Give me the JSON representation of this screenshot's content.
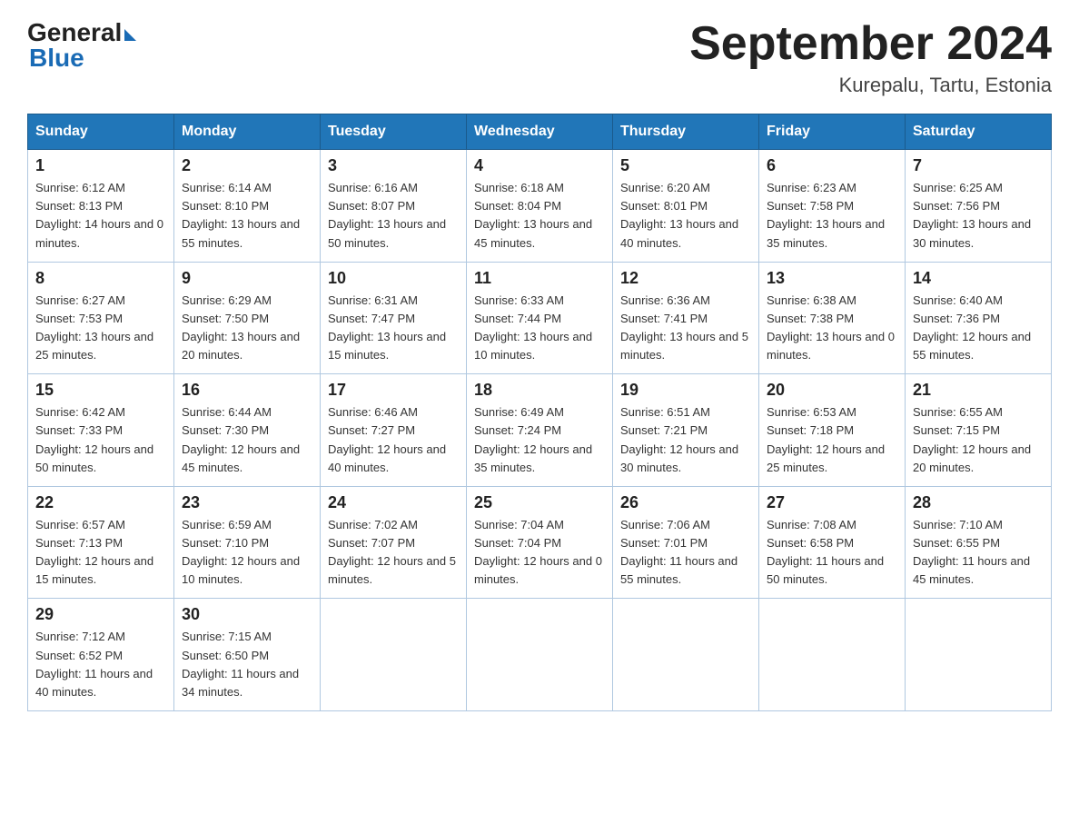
{
  "header": {
    "title": "September 2024",
    "subtitle": "Kurepalu, Tartu, Estonia",
    "logo_general": "General",
    "logo_blue": "Blue"
  },
  "days_of_week": [
    "Sunday",
    "Monday",
    "Tuesday",
    "Wednesday",
    "Thursday",
    "Friday",
    "Saturday"
  ],
  "weeks": [
    [
      {
        "day": "1",
        "sunrise": "Sunrise: 6:12 AM",
        "sunset": "Sunset: 8:13 PM",
        "daylight": "Daylight: 14 hours and 0 minutes."
      },
      {
        "day": "2",
        "sunrise": "Sunrise: 6:14 AM",
        "sunset": "Sunset: 8:10 PM",
        "daylight": "Daylight: 13 hours and 55 minutes."
      },
      {
        "day": "3",
        "sunrise": "Sunrise: 6:16 AM",
        "sunset": "Sunset: 8:07 PM",
        "daylight": "Daylight: 13 hours and 50 minutes."
      },
      {
        "day": "4",
        "sunrise": "Sunrise: 6:18 AM",
        "sunset": "Sunset: 8:04 PM",
        "daylight": "Daylight: 13 hours and 45 minutes."
      },
      {
        "day": "5",
        "sunrise": "Sunrise: 6:20 AM",
        "sunset": "Sunset: 8:01 PM",
        "daylight": "Daylight: 13 hours and 40 minutes."
      },
      {
        "day": "6",
        "sunrise": "Sunrise: 6:23 AM",
        "sunset": "Sunset: 7:58 PM",
        "daylight": "Daylight: 13 hours and 35 minutes."
      },
      {
        "day": "7",
        "sunrise": "Sunrise: 6:25 AM",
        "sunset": "Sunset: 7:56 PM",
        "daylight": "Daylight: 13 hours and 30 minutes."
      }
    ],
    [
      {
        "day": "8",
        "sunrise": "Sunrise: 6:27 AM",
        "sunset": "Sunset: 7:53 PM",
        "daylight": "Daylight: 13 hours and 25 minutes."
      },
      {
        "day": "9",
        "sunrise": "Sunrise: 6:29 AM",
        "sunset": "Sunset: 7:50 PM",
        "daylight": "Daylight: 13 hours and 20 minutes."
      },
      {
        "day": "10",
        "sunrise": "Sunrise: 6:31 AM",
        "sunset": "Sunset: 7:47 PM",
        "daylight": "Daylight: 13 hours and 15 minutes."
      },
      {
        "day": "11",
        "sunrise": "Sunrise: 6:33 AM",
        "sunset": "Sunset: 7:44 PM",
        "daylight": "Daylight: 13 hours and 10 minutes."
      },
      {
        "day": "12",
        "sunrise": "Sunrise: 6:36 AM",
        "sunset": "Sunset: 7:41 PM",
        "daylight": "Daylight: 13 hours and 5 minutes."
      },
      {
        "day": "13",
        "sunrise": "Sunrise: 6:38 AM",
        "sunset": "Sunset: 7:38 PM",
        "daylight": "Daylight: 13 hours and 0 minutes."
      },
      {
        "day": "14",
        "sunrise": "Sunrise: 6:40 AM",
        "sunset": "Sunset: 7:36 PM",
        "daylight": "Daylight: 12 hours and 55 minutes."
      }
    ],
    [
      {
        "day": "15",
        "sunrise": "Sunrise: 6:42 AM",
        "sunset": "Sunset: 7:33 PM",
        "daylight": "Daylight: 12 hours and 50 minutes."
      },
      {
        "day": "16",
        "sunrise": "Sunrise: 6:44 AM",
        "sunset": "Sunset: 7:30 PM",
        "daylight": "Daylight: 12 hours and 45 minutes."
      },
      {
        "day": "17",
        "sunrise": "Sunrise: 6:46 AM",
        "sunset": "Sunset: 7:27 PM",
        "daylight": "Daylight: 12 hours and 40 minutes."
      },
      {
        "day": "18",
        "sunrise": "Sunrise: 6:49 AM",
        "sunset": "Sunset: 7:24 PM",
        "daylight": "Daylight: 12 hours and 35 minutes."
      },
      {
        "day": "19",
        "sunrise": "Sunrise: 6:51 AM",
        "sunset": "Sunset: 7:21 PM",
        "daylight": "Daylight: 12 hours and 30 minutes."
      },
      {
        "day": "20",
        "sunrise": "Sunrise: 6:53 AM",
        "sunset": "Sunset: 7:18 PM",
        "daylight": "Daylight: 12 hours and 25 minutes."
      },
      {
        "day": "21",
        "sunrise": "Sunrise: 6:55 AM",
        "sunset": "Sunset: 7:15 PM",
        "daylight": "Daylight: 12 hours and 20 minutes."
      }
    ],
    [
      {
        "day": "22",
        "sunrise": "Sunrise: 6:57 AM",
        "sunset": "Sunset: 7:13 PM",
        "daylight": "Daylight: 12 hours and 15 minutes."
      },
      {
        "day": "23",
        "sunrise": "Sunrise: 6:59 AM",
        "sunset": "Sunset: 7:10 PM",
        "daylight": "Daylight: 12 hours and 10 minutes."
      },
      {
        "day": "24",
        "sunrise": "Sunrise: 7:02 AM",
        "sunset": "Sunset: 7:07 PM",
        "daylight": "Daylight: 12 hours and 5 minutes."
      },
      {
        "day": "25",
        "sunrise": "Sunrise: 7:04 AM",
        "sunset": "Sunset: 7:04 PM",
        "daylight": "Daylight: 12 hours and 0 minutes."
      },
      {
        "day": "26",
        "sunrise": "Sunrise: 7:06 AM",
        "sunset": "Sunset: 7:01 PM",
        "daylight": "Daylight: 11 hours and 55 minutes."
      },
      {
        "day": "27",
        "sunrise": "Sunrise: 7:08 AM",
        "sunset": "Sunset: 6:58 PM",
        "daylight": "Daylight: 11 hours and 50 minutes."
      },
      {
        "day": "28",
        "sunrise": "Sunrise: 7:10 AM",
        "sunset": "Sunset: 6:55 PM",
        "daylight": "Daylight: 11 hours and 45 minutes."
      }
    ],
    [
      {
        "day": "29",
        "sunrise": "Sunrise: 7:12 AM",
        "sunset": "Sunset: 6:52 PM",
        "daylight": "Daylight: 11 hours and 40 minutes."
      },
      {
        "day": "30",
        "sunrise": "Sunrise: 7:15 AM",
        "sunset": "Sunset: 6:50 PM",
        "daylight": "Daylight: 11 hours and 34 minutes."
      },
      null,
      null,
      null,
      null,
      null
    ]
  ]
}
